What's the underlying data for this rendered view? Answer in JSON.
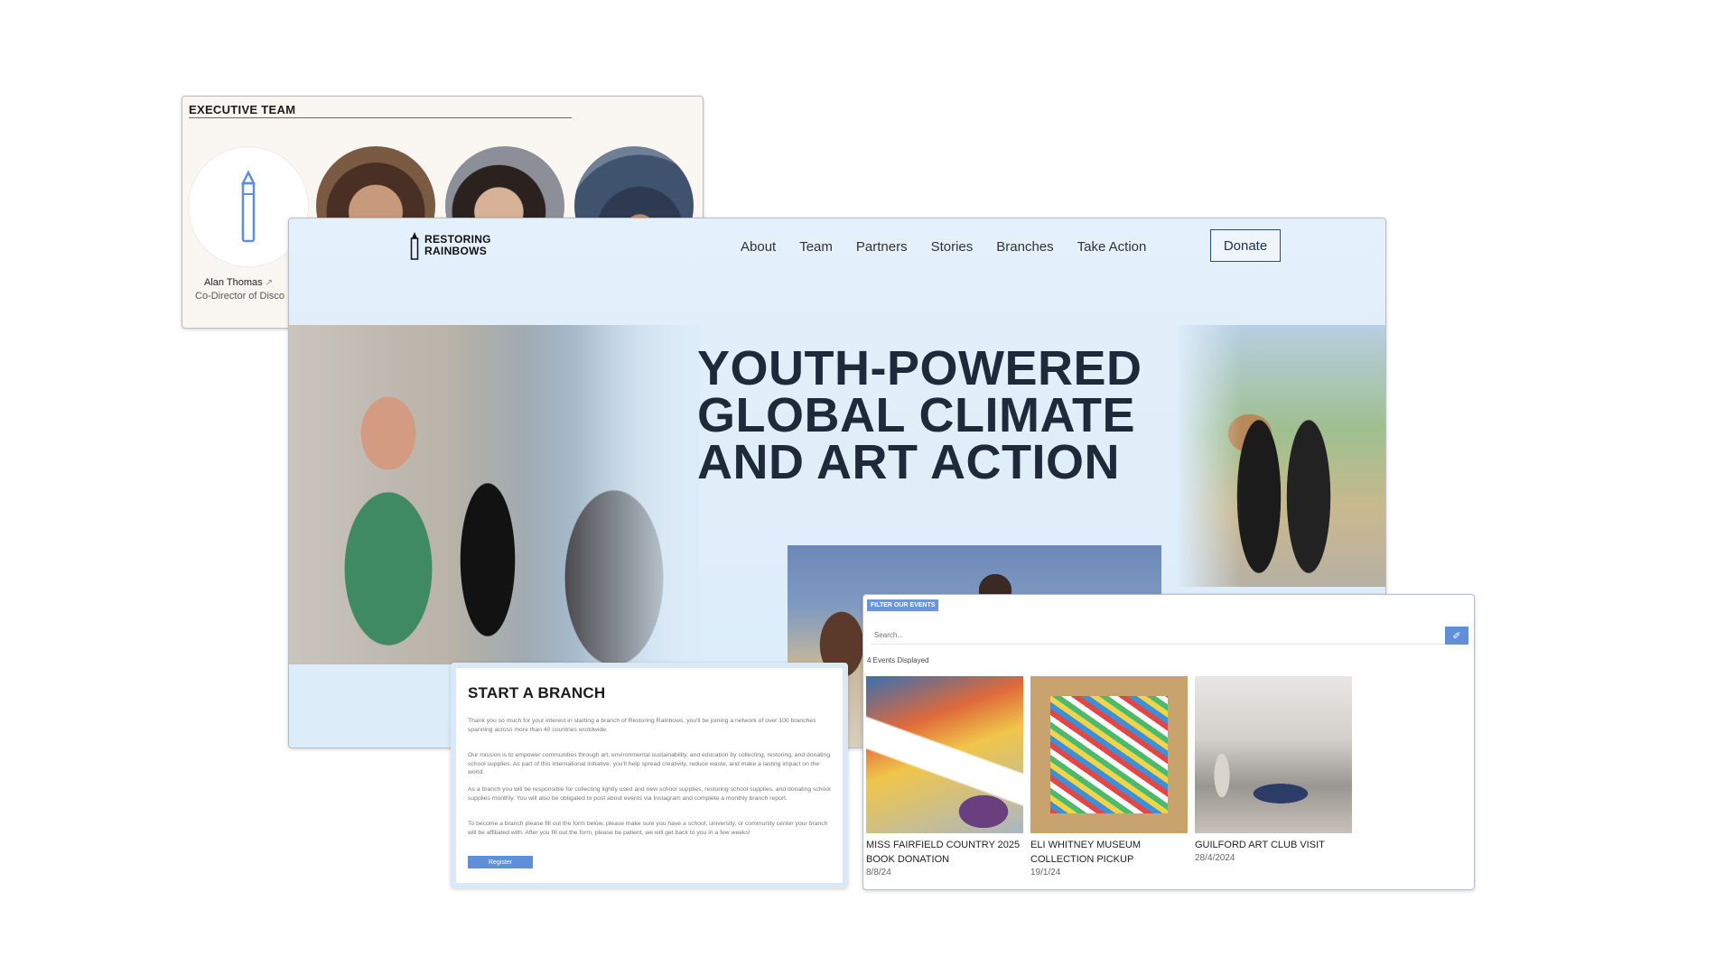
{
  "team": {
    "heading": "EXECUTIVE TEAM",
    "members": [
      {
        "name": "Alan Thomas",
        "role": "Co-Director of Disco"
      }
    ]
  },
  "hero": {
    "logo_line1": "RESTORING",
    "logo_line2": "RAINBOWS",
    "nav": [
      "About",
      "Team",
      "Partners",
      "Stories",
      "Branches",
      "Take Action"
    ],
    "donate_label": "Donate",
    "title_lines": [
      "YOUTH-POWERED",
      "GLOBAL CLIMATE",
      "AND ART ACTION"
    ]
  },
  "branch": {
    "title": "START A BRANCH",
    "paragraphs": [
      "Thank you so much for your interest in starting a branch of Restoring Rainbows, you'll be joining a network of over 100 branches spanning across more than 40 countries worldwide.",
      "Our mission is to empower communities through art, environmental sustainability, and education by collecting, restoring, and donating school supplies. As part of this international initiative, you'll help spread creativity, reduce waste, and make a lasting impact on the world.",
      "As a branch you will be responsible for collecting lightly used and new school supplies, restoring school supplies, and donating school supplies monthly. You will also be obligated to post about events via Instagram and complete a monthly branch report.",
      "To become a branch please fill out the form below, please make sure you have a school, university, or community center your branch will be affiliated with. After you fill out the form, please be patient, we will get back to you in a few weeks!"
    ],
    "register_label": "Register"
  },
  "events": {
    "filter_label": "FILTER OUR EVENTS",
    "search_placeholder": "Search...",
    "count_text": "4 Events Displayed",
    "items": [
      {
        "title": "MISS FAIRFIELD COUNTRY 2025 BOOK DONATION",
        "date": "8/8/24"
      },
      {
        "title": "ELI WHITNEY MUSEUM COLLECTION PICKUP",
        "date": "19/1/24"
      },
      {
        "title": "GUILFORD ART CLUB VISIT",
        "date": "28/4/2024"
      }
    ]
  },
  "colors": {
    "hero_bg": "#dcecf9",
    "accent": "#5f8fd6",
    "title": "#1e2a3a"
  },
  "icons": [
    "external-link-icon",
    "crayon-icon",
    "eraser-icon"
  ]
}
